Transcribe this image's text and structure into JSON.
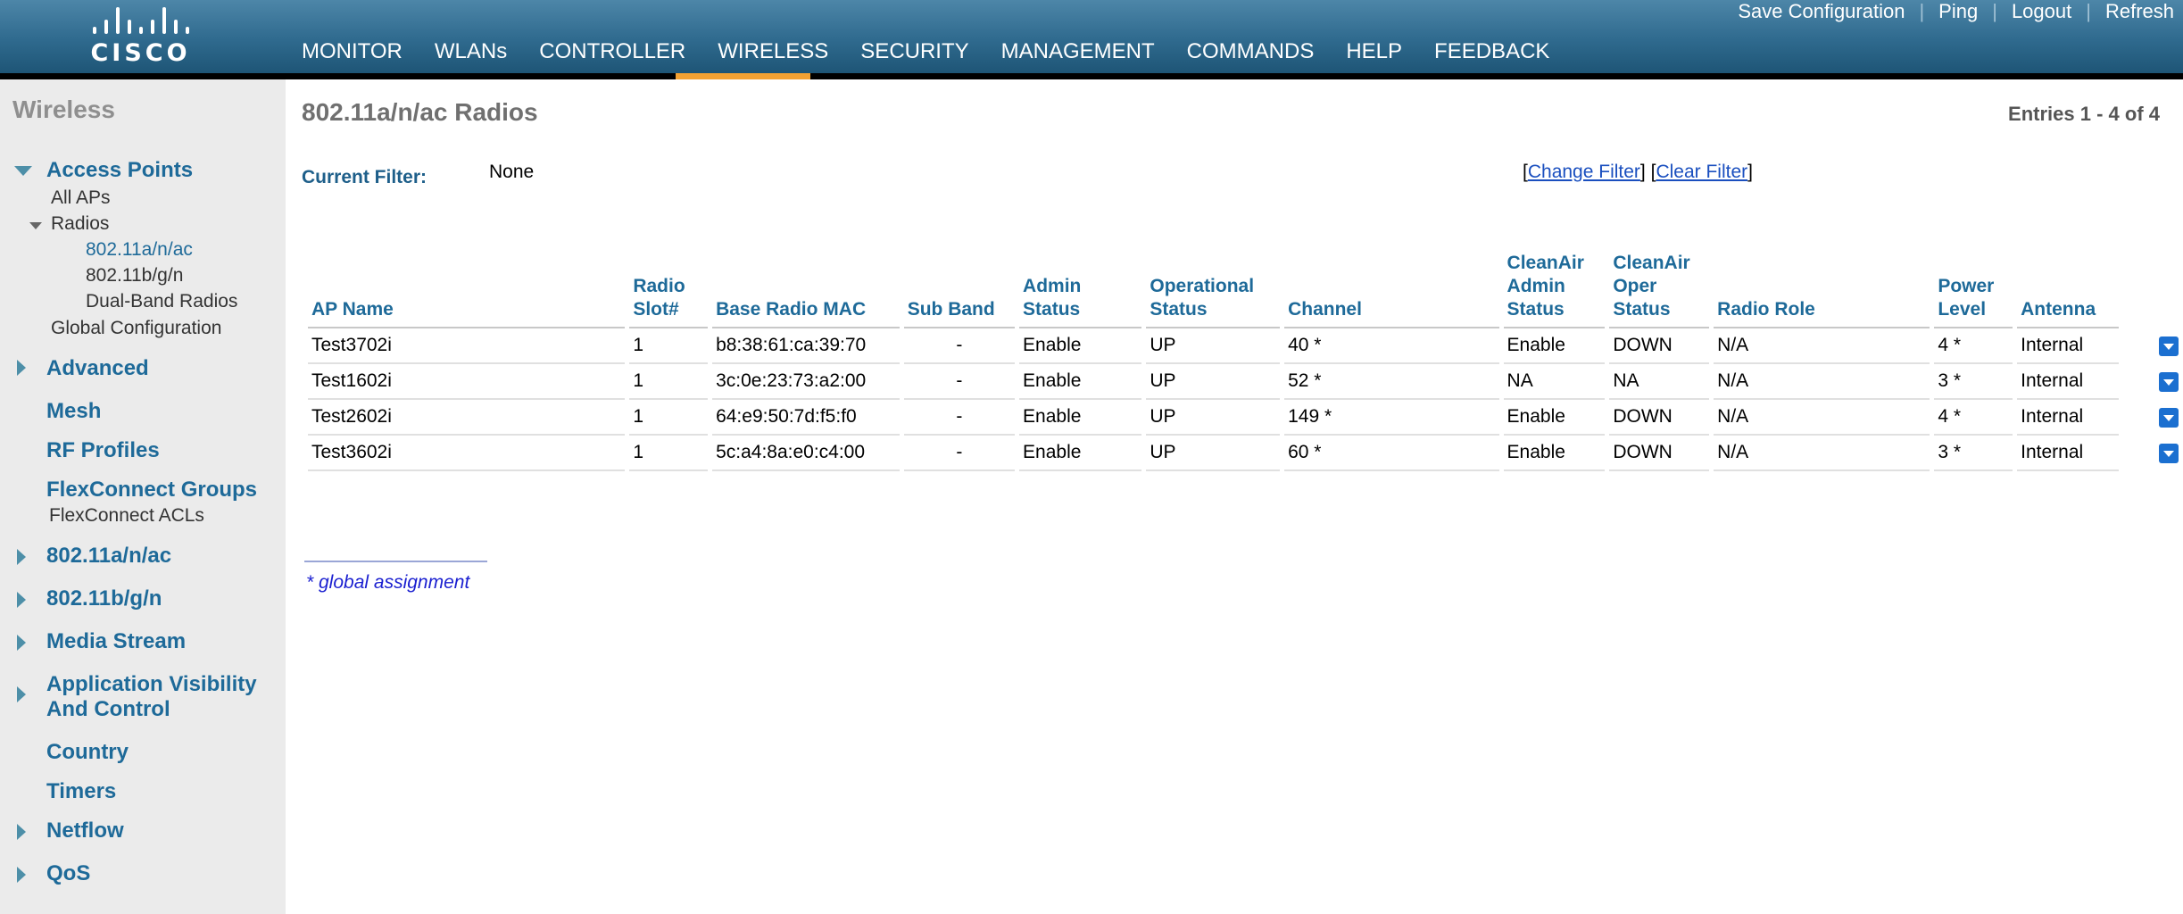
{
  "header": {
    "logo_text": "CISCO",
    "nav": [
      "MONITOR",
      "WLANs",
      "CONTROLLER",
      "WIRELESS",
      "SECURITY",
      "MANAGEMENT",
      "COMMANDS",
      "HELP",
      "FEEDBACK"
    ],
    "active_nav": "WIRELESS",
    "links": {
      "save": "Save Configuration",
      "ping": "Ping",
      "logout": "Logout",
      "refresh": "Refresh",
      "separator": "|"
    },
    "accent_color": "#f3a233"
  },
  "sidebar": {
    "title": "Wireless",
    "access_points": "Access Points",
    "all_aps": "All APs",
    "radios": "Radios",
    "radio_80211a": "802.11a/n/ac",
    "radio_80211b": "802.11b/g/n",
    "dual_band": "Dual-Band Radios",
    "global_config": "Global Configuration",
    "advanced": "Advanced",
    "mesh": "Mesh",
    "rf_profiles": "RF Profiles",
    "flexconnect_groups": "FlexConnect Groups",
    "flexconnect_acls": "FlexConnect ACLs",
    "s_80211a": "802.11a/n/ac",
    "s_80211b": "802.11b/g/n",
    "media_stream": "Media Stream",
    "avc_line1": "Application Visibility",
    "avc_line2": "And Control",
    "country": "Country",
    "timers": "Timers",
    "netflow": "Netflow",
    "qos": "QoS"
  },
  "main": {
    "title": "802.11a/n/ac Radios",
    "entries": "Entries 1 - 4 of 4",
    "filter_label": "Current Filter:",
    "filter_value": "None",
    "change_filter": "Change Filter",
    "clear_filter": "Clear Filter",
    "bracket_open": "[",
    "bracket_close": "]",
    "columns": {
      "ap_name": "AP Name",
      "radio_slot_1": "Radio",
      "radio_slot_2": "Slot#",
      "base_mac": "Base Radio MAC",
      "sub_band": "Sub Band",
      "admin_1": "Admin",
      "admin_2": "Status",
      "oper_1": "Operational",
      "oper_2": "Status",
      "channel": "Channel",
      "ca_admin_1": "CleanAir",
      "ca_admin_2": "Admin",
      "ca_admin_3": "Status",
      "ca_oper_1": "CleanAir",
      "ca_oper_2": "Oper",
      "ca_oper_3": "Status",
      "radio_role": "Radio Role",
      "power_1": "Power",
      "power_2": "Level",
      "antenna": "Antenna"
    },
    "rows": [
      {
        "ap_name": "Test3702i",
        "slot": "1",
        "mac": "b8:38:61:ca:39:70",
        "sub_band": "-",
        "admin": "Enable",
        "oper": "UP",
        "channel": "40 *",
        "ca_admin": "Enable",
        "ca_oper": "DOWN",
        "role": "N/A",
        "power": "4 *",
        "antenna": "Internal"
      },
      {
        "ap_name": "Test1602i",
        "slot": "1",
        "mac": "3c:0e:23:73:a2:00",
        "sub_band": "-",
        "admin": "Enable",
        "oper": "UP",
        "channel": "52 *",
        "ca_admin": "NA",
        "ca_oper": "NA",
        "role": "N/A",
        "power": "3 *",
        "antenna": "Internal"
      },
      {
        "ap_name": "Test2602i",
        "slot": "1",
        "mac": "64:e9:50:7d:f5:f0",
        "sub_band": "-",
        "admin": "Enable",
        "oper": "UP",
        "channel": "149 *",
        "ca_admin": "Enable",
        "ca_oper": "DOWN",
        "role": "N/A",
        "power": "4 *",
        "antenna": "Internal"
      },
      {
        "ap_name": "Test3602i",
        "slot": "1",
        "mac": "5c:a4:8a:e0:c4:00",
        "sub_band": "-",
        "admin": "Enable",
        "oper": "UP",
        "channel": "60 *",
        "ca_admin": "Enable",
        "ca_oper": "DOWN",
        "role": "N/A",
        "power": "3 *",
        "antenna": "Internal"
      }
    ],
    "footnote": "* global assignment"
  }
}
